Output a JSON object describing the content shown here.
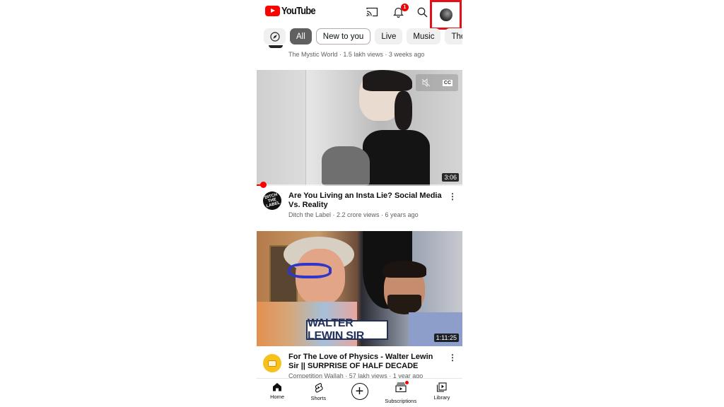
{
  "header": {
    "app_name": "YouTube",
    "notification_count": "1",
    "icons": [
      "cast-icon",
      "bell-icon",
      "search-icon",
      "account-avatar"
    ]
  },
  "chips": [
    {
      "label": "",
      "icon": "explore-icon"
    },
    {
      "label": "All",
      "state": "selected"
    },
    {
      "label": "New to you"
    },
    {
      "label": "Live"
    },
    {
      "label": "Music"
    },
    {
      "label": "Thou"
    }
  ],
  "previous_video": {
    "meta": "The Mystic World · 1.5 lakh views · 3 weeks ago"
  },
  "videos": [
    {
      "title": "Are You Living an Insta Lie? Social Media Vs. Reality",
      "meta": "Ditch the Label · 2.2 crore views · 6 years ago",
      "channel_avatar_text": "DITCH THE LABEL",
      "duration": "3:06",
      "controls": [
        "mute-icon",
        "captions-icon"
      ],
      "captions_label": "CC",
      "watch_progress_fraction": 0.03
    },
    {
      "title": "For The Love of Physics - Walter Lewin Sir || SURPRISE OF HALF DECADE",
      "meta": "Competition Wallah · 57 lakh views · 1 year ago",
      "thumbnail_text": "WALTER LEWIN SIR",
      "duration": "1:11:25"
    }
  ],
  "bottom_nav": [
    {
      "label": "Home",
      "icon": "home-icon",
      "active": true
    },
    {
      "label": "Shorts",
      "icon": "shorts-icon"
    },
    {
      "label": "",
      "icon": "create-icon"
    },
    {
      "label": "Subscriptions",
      "icon": "subscriptions-icon",
      "has_dot": true
    },
    {
      "label": "Library",
      "icon": "library-icon"
    }
  ],
  "colors": {
    "brand_red": "#ff0000",
    "highlight_box": "#e3101a",
    "chip_selected": "#606060",
    "text_secondary": "#606060"
  }
}
